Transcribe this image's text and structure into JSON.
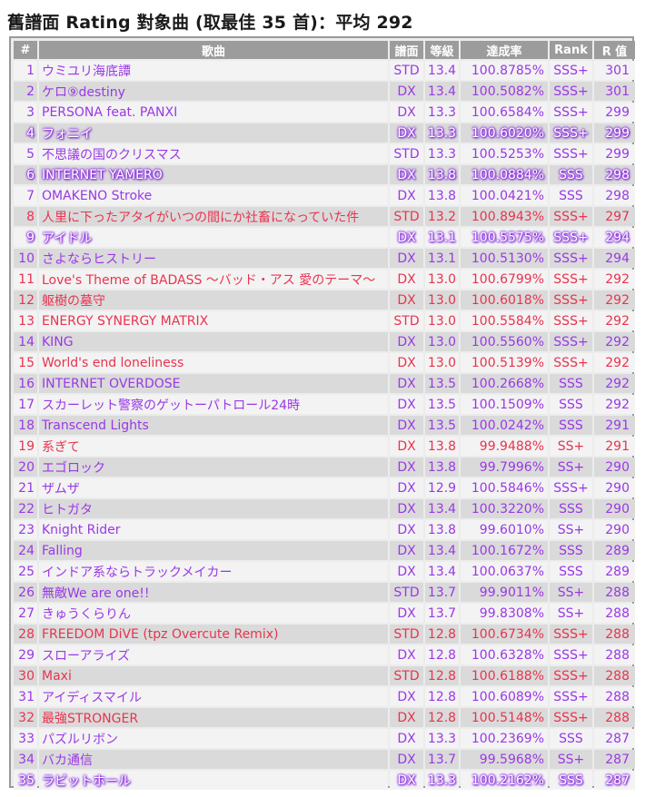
{
  "page": {
    "title": "舊譜面 Rating 對象曲 (取最佳 35 首)：平均 292"
  },
  "table": {
    "headers": [
      "#",
      "歌曲",
      "譜面",
      "等級",
      "達成率",
      "Rank",
      "R 值"
    ],
    "rows": [
      {
        "n": "1",
        "song": "ウミユリ海底譚",
        "chart": "STD",
        "level": "13.4",
        "ach": "100.8785%",
        "rank": "SSS+",
        "rating": "301",
        "color": "purple",
        "glow": false
      },
      {
        "n": "2",
        "song": "ケロ⑨destiny",
        "chart": "DX",
        "level": "13.4",
        "ach": "100.5082%",
        "rank": "SSS+",
        "rating": "301",
        "color": "purple",
        "glow": false
      },
      {
        "n": "3",
        "song": "PERSONA feat. PANXI",
        "chart": "DX",
        "level": "13.3",
        "ach": "100.6584%",
        "rank": "SSS+",
        "rating": "299",
        "color": "purple",
        "glow": false
      },
      {
        "n": "4",
        "song": "フォニイ",
        "chart": "DX",
        "level": "13.3",
        "ach": "100.6020%",
        "rank": "SSS+",
        "rating": "299",
        "color": "purple",
        "glow": true
      },
      {
        "n": "5",
        "song": "不思議の国のクリスマス",
        "chart": "STD",
        "level": "13.3",
        "ach": "100.5253%",
        "rank": "SSS+",
        "rating": "299",
        "color": "purple",
        "glow": false
      },
      {
        "n": "6",
        "song": "INTERNET YAMERO",
        "chart": "DX",
        "level": "13.8",
        "ach": "100.0884%",
        "rank": "SSS",
        "rating": "298",
        "color": "purple",
        "glow": true
      },
      {
        "n": "7",
        "song": "OMAKENO Stroke",
        "chart": "DX",
        "level": "13.8",
        "ach": "100.0421%",
        "rank": "SSS",
        "rating": "298",
        "color": "purple",
        "glow": false
      },
      {
        "n": "8",
        "song": "人里に下ったアタイがいつの間にか社畜になっていた件",
        "chart": "STD",
        "level": "13.2",
        "ach": "100.8943%",
        "rank": "SSS+",
        "rating": "297",
        "color": "red",
        "glow": false
      },
      {
        "n": "9",
        "song": "アイドル",
        "chart": "DX",
        "level": "13.1",
        "ach": "100.5575%",
        "rank": "SSS+",
        "rating": "294",
        "color": "purple",
        "glow": true
      },
      {
        "n": "10",
        "song": "さよならヒストリー",
        "chart": "DX",
        "level": "13.1",
        "ach": "100.5130%",
        "rank": "SSS+",
        "rating": "294",
        "color": "purple",
        "glow": false
      },
      {
        "n": "11",
        "song": "Love's Theme of BADASS ～バッド・アス 愛のテーマ～",
        "chart": "DX",
        "level": "13.0",
        "ach": "100.6799%",
        "rank": "SSS+",
        "rating": "292",
        "color": "red",
        "glow": false
      },
      {
        "n": "12",
        "song": "躯樹の墓守",
        "chart": "DX",
        "level": "13.0",
        "ach": "100.6018%",
        "rank": "SSS+",
        "rating": "292",
        "color": "red",
        "glow": false
      },
      {
        "n": "13",
        "song": "ENERGY SYNERGY MATRIX",
        "chart": "STD",
        "level": "13.0",
        "ach": "100.5584%",
        "rank": "SSS+",
        "rating": "292",
        "color": "red",
        "glow": false
      },
      {
        "n": "14",
        "song": "KING",
        "chart": "DX",
        "level": "13.0",
        "ach": "100.5560%",
        "rank": "SSS+",
        "rating": "292",
        "color": "purple",
        "glow": false
      },
      {
        "n": "15",
        "song": "World's end loneliness",
        "chart": "DX",
        "level": "13.0",
        "ach": "100.5139%",
        "rank": "SSS+",
        "rating": "292",
        "color": "red",
        "glow": false
      },
      {
        "n": "16",
        "song": "INTERNET OVERDOSE",
        "chart": "DX",
        "level": "13.5",
        "ach": "100.2668%",
        "rank": "SSS",
        "rating": "292",
        "color": "purple",
        "glow": false
      },
      {
        "n": "17",
        "song": "スカーレット警察のゲットーパトロール24時",
        "chart": "DX",
        "level": "13.5",
        "ach": "100.1509%",
        "rank": "SSS",
        "rating": "292",
        "color": "purple",
        "glow": false
      },
      {
        "n": "18",
        "song": "Transcend Lights",
        "chart": "DX",
        "level": "13.5",
        "ach": "100.0242%",
        "rank": "SSS",
        "rating": "291",
        "color": "purple",
        "glow": false
      },
      {
        "n": "19",
        "song": "系ぎて",
        "chart": "DX",
        "level": "13.8",
        "ach": "99.9488%",
        "rank": "SS+",
        "rating": "291",
        "color": "red",
        "glow": false
      },
      {
        "n": "20",
        "song": "エゴロック",
        "chart": "DX",
        "level": "13.8",
        "ach": "99.7996%",
        "rank": "SS+",
        "rating": "290",
        "color": "purple",
        "glow": false
      },
      {
        "n": "21",
        "song": "ザムザ",
        "chart": "DX",
        "level": "12.9",
        "ach": "100.5846%",
        "rank": "SSS+",
        "rating": "290",
        "color": "purple",
        "glow": false
      },
      {
        "n": "22",
        "song": "ヒトガタ",
        "chart": "DX",
        "level": "13.4",
        "ach": "100.3220%",
        "rank": "SSS",
        "rating": "290",
        "color": "purple",
        "glow": false
      },
      {
        "n": "23",
        "song": "Knight Rider",
        "chart": "DX",
        "level": "13.8",
        "ach": "99.6010%",
        "rank": "SS+",
        "rating": "290",
        "color": "purple",
        "glow": false
      },
      {
        "n": "24",
        "song": "Falling",
        "chart": "DX",
        "level": "13.4",
        "ach": "100.1672%",
        "rank": "SSS",
        "rating": "289",
        "color": "purple",
        "glow": false
      },
      {
        "n": "25",
        "song": "インドア系ならトラックメイカー",
        "chart": "DX",
        "level": "13.4",
        "ach": "100.0637%",
        "rank": "SSS",
        "rating": "289",
        "color": "purple",
        "glow": false
      },
      {
        "n": "26",
        "song": "無敵We are one!!",
        "chart": "STD",
        "level": "13.7",
        "ach": "99.9011%",
        "rank": "SS+",
        "rating": "288",
        "color": "purple",
        "glow": false
      },
      {
        "n": "27",
        "song": "きゅうくらりん",
        "chart": "DX",
        "level": "13.7",
        "ach": "99.8308%",
        "rank": "SS+",
        "rating": "288",
        "color": "purple",
        "glow": false
      },
      {
        "n": "28",
        "song": "FREEDOM DiVE (tpz Overcute Remix)",
        "chart": "STD",
        "level": "12.8",
        "ach": "100.6734%",
        "rank": "SSS+",
        "rating": "288",
        "color": "red",
        "glow": false
      },
      {
        "n": "29",
        "song": "スローアライズ",
        "chart": "DX",
        "level": "12.8",
        "ach": "100.6328%",
        "rank": "SSS+",
        "rating": "288",
        "color": "purple",
        "glow": false
      },
      {
        "n": "30",
        "song": "Maxi",
        "chart": "STD",
        "level": "12.8",
        "ach": "100.6188%",
        "rank": "SSS+",
        "rating": "288",
        "color": "red",
        "glow": false
      },
      {
        "n": "31",
        "song": "アイディスマイル",
        "chart": "DX",
        "level": "12.8",
        "ach": "100.6089%",
        "rank": "SSS+",
        "rating": "288",
        "color": "purple",
        "glow": false
      },
      {
        "n": "32",
        "song": "最強STRONGER",
        "chart": "DX",
        "level": "12.8",
        "ach": "100.5148%",
        "rank": "SSS+",
        "rating": "288",
        "color": "red",
        "glow": false
      },
      {
        "n": "33",
        "song": "パズルリボン",
        "chart": "DX",
        "level": "13.3",
        "ach": "100.2369%",
        "rank": "SSS",
        "rating": "287",
        "color": "purple",
        "glow": false
      },
      {
        "n": "34",
        "song": "バカ通信",
        "chart": "DX",
        "level": "13.7",
        "ach": "99.5968%",
        "rank": "SS+",
        "rating": "287",
        "color": "purple",
        "glow": false
      },
      {
        "n": "35",
        "song": "ラビットホール",
        "chart": "DX",
        "level": "13.3",
        "ach": "100.2162%",
        "rank": "SSS",
        "rating": "287",
        "color": "purple",
        "glow": true
      }
    ]
  },
  "colors": {
    "purple_text": "#9a38e6",
    "red_text": "#e7344f",
    "header_bg": "#9c9c9c",
    "row_light": "#f3f3f3",
    "row_dark": "#dadada"
  }
}
